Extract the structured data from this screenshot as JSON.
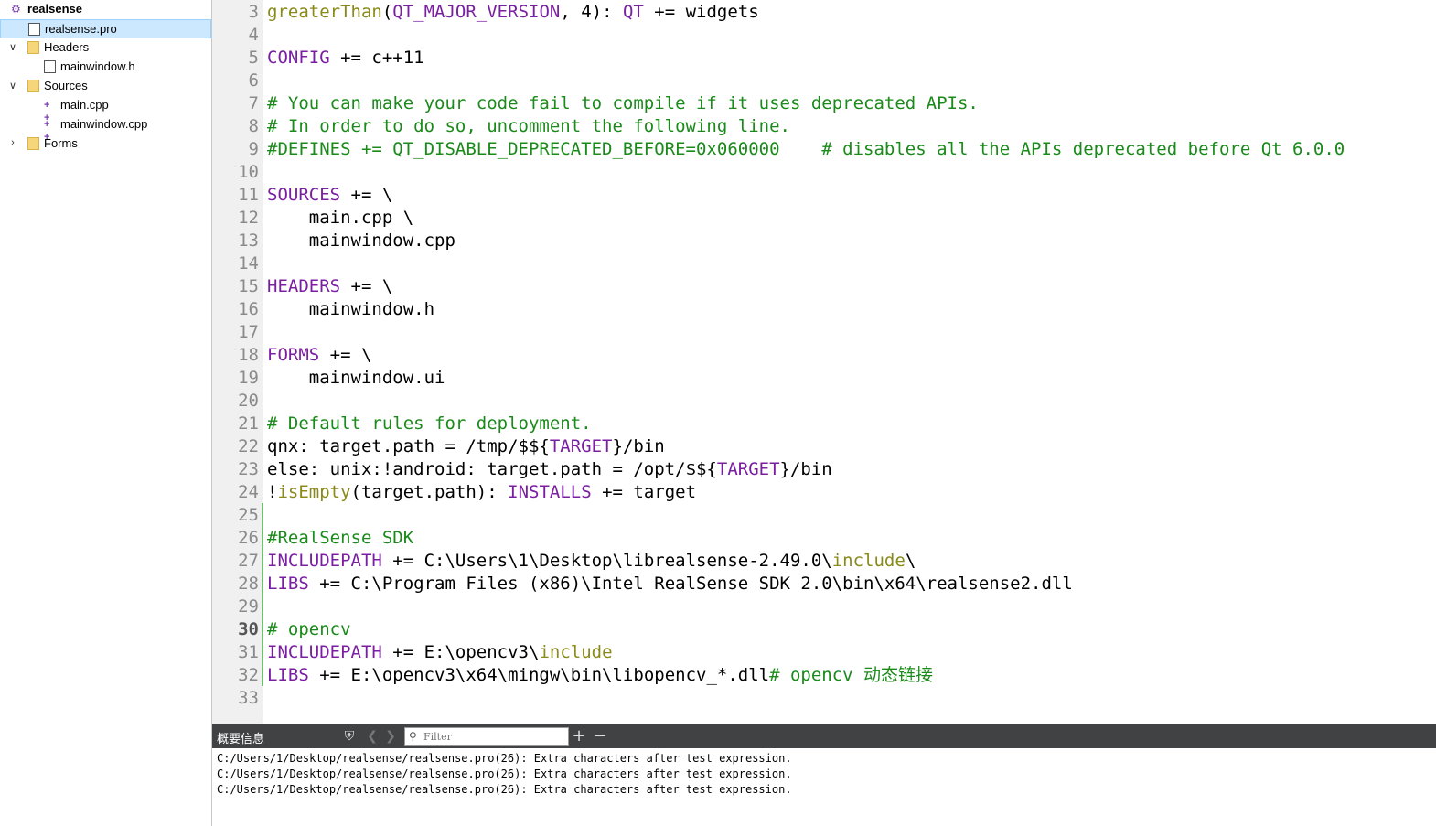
{
  "sidebar": {
    "items": [
      {
        "label": "realsense",
        "icon": "qt-project-icon",
        "depth": 0,
        "arrow": "",
        "selected": false,
        "bold": true
      },
      {
        "label": "realsense.pro",
        "icon": "pro-file-icon",
        "depth": 1,
        "arrow": "",
        "selected": true,
        "bold": false
      },
      {
        "label": "Headers",
        "icon": "folder-icon",
        "depth": 1,
        "arrow": "expanded",
        "selected": false,
        "bold": false
      },
      {
        "label": "mainwindow.h",
        "icon": "header-file-icon",
        "depth": 2,
        "arrow": "",
        "selected": false,
        "bold": false
      },
      {
        "label": "Sources",
        "icon": "folder-icon",
        "depth": 1,
        "arrow": "expanded",
        "selected": false,
        "bold": false
      },
      {
        "label": "main.cpp",
        "icon": "cpp-file-icon",
        "depth": 2,
        "arrow": "",
        "selected": false,
        "bold": false
      },
      {
        "label": "mainwindow.cpp",
        "icon": "cpp-file-icon",
        "depth": 2,
        "arrow": "",
        "selected": false,
        "bold": false
      },
      {
        "label": "Forms",
        "icon": "folder-icon",
        "depth": 1,
        "arrow": "collapsed",
        "selected": false,
        "bold": false
      }
    ]
  },
  "editor": {
    "current_line": 30,
    "lines": [
      {
        "n": "3",
        "tokens": [
          [
            "fn",
            "greaterThan"
          ],
          [
            "p",
            "("
          ],
          [
            "kw",
            "QT_MAJOR_VERSION"
          ],
          [
            "p",
            ", 4): "
          ],
          [
            "kw",
            "QT"
          ],
          [
            "p",
            " += widgets"
          ]
        ]
      },
      {
        "n": "4",
        "tokens": []
      },
      {
        "n": "5",
        "tokens": [
          [
            "kw",
            "CONFIG"
          ],
          [
            "p",
            " += c++11"
          ]
        ]
      },
      {
        "n": "6",
        "tokens": []
      },
      {
        "n": "7",
        "tokens": [
          [
            "cm",
            "# You can make your code fail to compile if it uses deprecated APIs."
          ]
        ]
      },
      {
        "n": "8",
        "tokens": [
          [
            "cm",
            "# In order to do so, uncomment the following line."
          ]
        ]
      },
      {
        "n": "9",
        "tokens": [
          [
            "cm",
            "#DEFINES += QT_DISABLE_DEPRECATED_BEFORE=0x060000    # disables all the APIs deprecated before Qt 6.0.0"
          ]
        ]
      },
      {
        "n": "10",
        "tokens": []
      },
      {
        "n": "11",
        "tokens": [
          [
            "kw",
            "SOURCES"
          ],
          [
            "p",
            " += \\"
          ]
        ]
      },
      {
        "n": "12",
        "tokens": [
          [
            "p",
            "    main.cpp \\"
          ]
        ]
      },
      {
        "n": "13",
        "tokens": [
          [
            "p",
            "    mainwindow.cpp"
          ]
        ]
      },
      {
        "n": "14",
        "tokens": []
      },
      {
        "n": "15",
        "tokens": [
          [
            "kw",
            "HEADERS"
          ],
          [
            "p",
            " += \\"
          ]
        ]
      },
      {
        "n": "16",
        "tokens": [
          [
            "p",
            "    mainwindow.h"
          ]
        ]
      },
      {
        "n": "17",
        "tokens": []
      },
      {
        "n": "18",
        "tokens": [
          [
            "kw",
            "FORMS"
          ],
          [
            "p",
            " += \\"
          ]
        ]
      },
      {
        "n": "19",
        "tokens": [
          [
            "p",
            "    mainwindow.ui"
          ]
        ]
      },
      {
        "n": "20",
        "tokens": []
      },
      {
        "n": "21",
        "tokens": [
          [
            "cm",
            "# Default rules for deployment."
          ]
        ]
      },
      {
        "n": "22",
        "tokens": [
          [
            "p",
            "qnx: target.path = /tmp/$${"
          ],
          [
            "kw",
            "TARGET"
          ],
          [
            "p",
            "}/bin"
          ]
        ]
      },
      {
        "n": "23",
        "tokens": [
          [
            "p",
            "else: unix:!android: target.path = /opt/$${"
          ],
          [
            "kw",
            "TARGET"
          ],
          [
            "p",
            "}/bin"
          ]
        ]
      },
      {
        "n": "24",
        "tokens": [
          [
            "p",
            "!"
          ],
          [
            "fn",
            "isEmpty"
          ],
          [
            "p",
            "(target.path): "
          ],
          [
            "kw",
            "INSTALLS"
          ],
          [
            "p",
            " += target"
          ]
        ]
      },
      {
        "n": "25",
        "tokens": []
      },
      {
        "n": "26",
        "tokens": [
          [
            "cm",
            "#RealSense SDK"
          ]
        ]
      },
      {
        "n": "27",
        "tokens": [
          [
            "kw",
            "INCLUDEPATH"
          ],
          [
            "p",
            " += C:\\Users\\1\\Desktop\\librealsense-2.49.0\\"
          ],
          [
            "fn",
            "include"
          ],
          [
            "p",
            "\\"
          ]
        ]
      },
      {
        "n": "28",
        "tokens": [
          [
            "kw",
            "LIBS"
          ],
          [
            "p",
            " += C:\\Program Files (x86)\\Intel RealSense SDK 2.0\\bin\\x64\\realsense2.dll"
          ]
        ]
      },
      {
        "n": "29",
        "tokens": []
      },
      {
        "n": "30",
        "tokens": [
          [
            "cm",
            "# opencv"
          ]
        ]
      },
      {
        "n": "31",
        "tokens": [
          [
            "kw",
            "INCLUDEPATH"
          ],
          [
            "p",
            " += E:\\opencv3\\"
          ],
          [
            "fn",
            "include"
          ]
        ]
      },
      {
        "n": "32",
        "tokens": [
          [
            "kw",
            "LIBS"
          ],
          [
            "p",
            " += E:\\opencv3\\x64\\mingw\\bin\\libopencv_*.dll"
          ],
          [
            "cm",
            "# opencv 动态链接"
          ]
        ]
      },
      {
        "n": "33",
        "tokens": []
      }
    ]
  },
  "output": {
    "title": "概要信息",
    "filter_placeholder": "Filter",
    "lines": [
      "C:/Users/1/Desktop/realsense/realsense.pro(26): Extra characters after test expression.",
      "C:/Users/1/Desktop/realsense/realsense.pro(26): Extra characters after test expression.",
      "C:/Users/1/Desktop/realsense/realsense.pro(26): Extra characters after test expression."
    ]
  },
  "colors": {
    "keyword": "#7b1fa2",
    "function": "#8a8a1a",
    "comment": "#1a8a1a",
    "selection": "#cce8ff",
    "toolbar": "#404244"
  }
}
